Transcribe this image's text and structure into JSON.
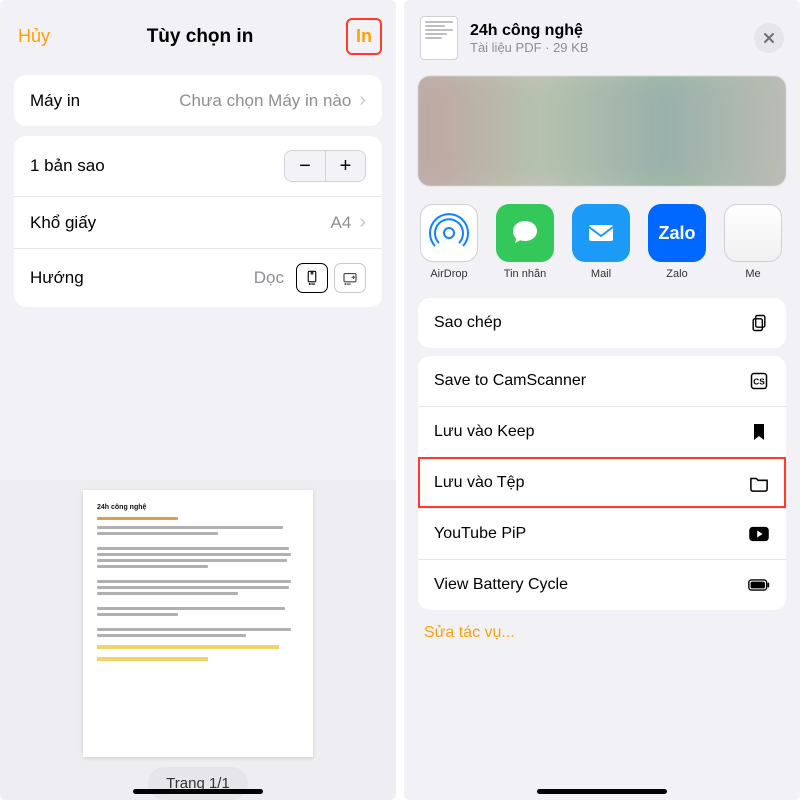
{
  "left": {
    "cancel": "Hủy",
    "title": "Tùy chọn in",
    "print": "In",
    "printer": {
      "label": "Máy in",
      "value": "Chưa chọn Máy in nào"
    },
    "copies": {
      "label": "1 bản sao"
    },
    "paper": {
      "label": "Khổ giấy",
      "value": "A4"
    },
    "orientation": {
      "label": "Hướng",
      "value": "Dọc"
    },
    "doc_title": "24h công nghệ",
    "page_indicator": "Trang 1/1"
  },
  "right": {
    "file_title": "24h công nghệ",
    "file_sub": "Tài liệu PDF · 29 KB",
    "apps": [
      {
        "name": "AirDrop"
      },
      {
        "name": "Tin nhắn"
      },
      {
        "name": "Mail"
      },
      {
        "name": "Zalo"
      },
      {
        "name": "Me"
      }
    ],
    "actions": {
      "copy": "Sao chép",
      "camscanner": "Save to CamScanner",
      "keep": "Lưu vào Keep",
      "files": "Lưu vào Tệp",
      "youtube": "YouTube PiP",
      "battery": "View Battery Cycle"
    },
    "edit": "Sửa tác vụ..."
  }
}
